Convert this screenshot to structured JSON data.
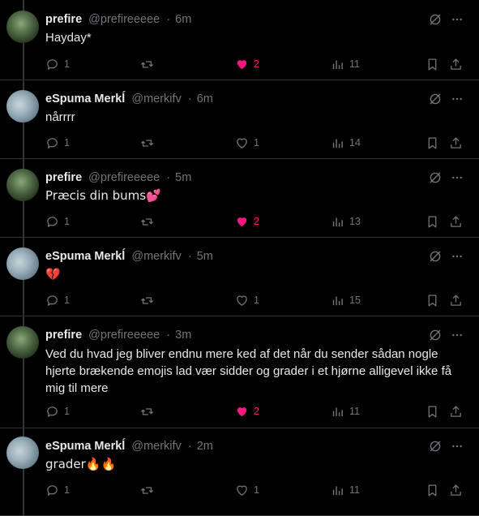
{
  "tweets": [
    {
      "name": "prefire",
      "handle": "@prefireeeee",
      "time": "6m",
      "text": "Hayday*",
      "avatar": "green",
      "replies": "1",
      "likes": "2",
      "liked": true,
      "views": "11"
    },
    {
      "name": "eSpuma Merkĺ",
      "handle": "@merkifv",
      "time": "6m",
      "text": "nårrrr",
      "avatar": "pale",
      "replies": "1",
      "likes": "1",
      "liked": false,
      "views": "14"
    },
    {
      "name": "prefire",
      "handle": "@prefireeeee",
      "time": "5m",
      "text": "Præcis din bums💕",
      "avatar": "green",
      "replies": "1",
      "likes": "2",
      "liked": true,
      "views": "13"
    },
    {
      "name": "eSpuma Merkĺ",
      "handle": "@merkifv",
      "time": "5m",
      "text": "💔",
      "avatar": "pale",
      "replies": "1",
      "likes": "1",
      "liked": false,
      "views": "15"
    },
    {
      "name": "prefire",
      "handle": "@prefireeeee",
      "time": "3m",
      "text": "Ved du hvad jeg bliver endnu mere ked af det når du sender sådan nogle hjerte brækende emojis lad vær sidder og grader i et hjørne alligevel ikke få mig til mere",
      "avatar": "green",
      "replies": "1",
      "likes": "2",
      "liked": true,
      "views": "11"
    },
    {
      "name": "eSpuma Merkĺ",
      "handle": "@merkifv",
      "time": "2m",
      "text": "grader🔥🔥",
      "avatar": "pale",
      "replies": "1",
      "likes": "1",
      "liked": false,
      "views": "11"
    }
  ],
  "colors": {
    "background": "#000000",
    "text": "#e7e9ea",
    "muted": "#71767b",
    "like": "#f91880",
    "divider": "#2f3336"
  },
  "icons": [
    "reply-icon",
    "retweet-icon",
    "heart-icon",
    "views-icon",
    "bookmark-icon",
    "share-icon",
    "grok-icon",
    "more-icon"
  ]
}
